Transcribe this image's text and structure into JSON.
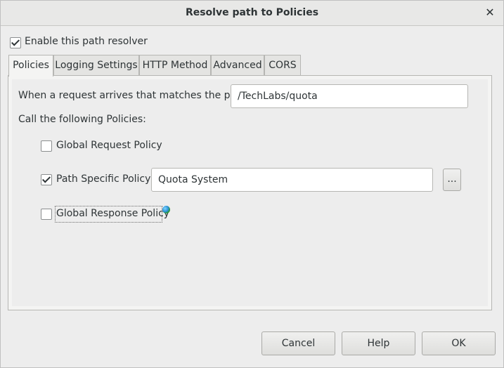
{
  "window": {
    "title": "Resolve path to Policies",
    "close_glyph": "✕"
  },
  "enable_resolver": {
    "label": "Enable this path resolver",
    "checked": true
  },
  "tabs": [
    {
      "label": "Policies",
      "active": true
    },
    {
      "label": "Logging Settings",
      "active": false
    },
    {
      "label": "HTTP Method",
      "active": false
    },
    {
      "label": "Advanced",
      "active": false
    },
    {
      "label": "CORS",
      "active": false
    }
  ],
  "policies_tab": {
    "path_label": "When a request arrives that matches the path:",
    "path_value": "/TechLabs/quota",
    "call_label": "Call the following Policies:",
    "global_request": {
      "label": "Global Request Policy",
      "checked": false
    },
    "path_specific": {
      "label": "Path Specific Policy:",
      "checked": true,
      "value": "Quota System",
      "browse_label": "..."
    },
    "global_response": {
      "label": "Global Response Policy",
      "checked": false,
      "icon": "globe-icon"
    }
  },
  "footer": {
    "cancel_label": "Cancel",
    "help_label": "Help",
    "ok_label": "OK"
  }
}
